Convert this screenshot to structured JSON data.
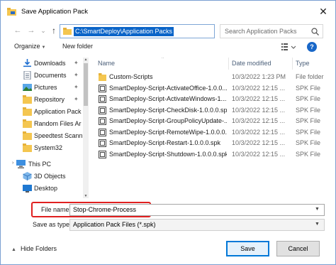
{
  "window": {
    "title": "Save Application Pack",
    "close_glyph": "✕"
  },
  "nav": {
    "back_glyph": "←",
    "forward_glyph": "→",
    "recent_glyph": "⌄",
    "up_glyph": "↑",
    "address": "C:\\SmartDeploy\\Application Packs",
    "refresh_glyph": "↻",
    "search_placeholder": "Search Application Packs"
  },
  "toolbar": {
    "organize_label": "Organize",
    "new_folder_label": "New folder",
    "help_glyph": "?"
  },
  "sidebar": {
    "items": [
      {
        "label": "Downloads",
        "icon": "download-icon",
        "pinned": true
      },
      {
        "label": "Documents",
        "icon": "document-icon",
        "pinned": true
      },
      {
        "label": "Pictures",
        "icon": "picture-icon",
        "pinned": true
      },
      {
        "label": "Repository",
        "icon": "folder-icon",
        "pinned": true
      },
      {
        "label": "Application Pack",
        "icon": "folder-icon",
        "pinned": false
      },
      {
        "label": "Random Files Ar",
        "icon": "folder-icon",
        "pinned": false
      },
      {
        "label": "Speedtest Scann",
        "icon": "folder-icon",
        "pinned": false
      },
      {
        "label": "System32",
        "icon": "folder-icon",
        "pinned": false
      },
      {
        "label": "This PC",
        "icon": "computer-icon",
        "pinned": false
      },
      {
        "label": "3D Objects",
        "icon": "cube-icon",
        "pinned": false
      },
      {
        "label": "Desktop",
        "icon": "desktop-icon",
        "pinned": false
      }
    ],
    "pin_glyph": "📌"
  },
  "columns": {
    "name": "Name",
    "date": "Date modified",
    "type": "Type"
  },
  "files": [
    {
      "name": "Custom-Scripts",
      "date": "10/3/2022 1:23 PM",
      "type": "File folder",
      "icon": "folder-icon"
    },
    {
      "name": "SmartDeploy-Script-ActivateOffice-1.0.0....",
      "date": "10/3/2022 12:15 ...",
      "type": "SPK File",
      "icon": "spk-file-icon"
    },
    {
      "name": "SmartDeploy-Script-ActivateWindows-1....",
      "date": "10/3/2022 12:15 ...",
      "type": "SPK File",
      "icon": "spk-file-icon"
    },
    {
      "name": "SmartDeploy-Script-CheckDisk-1.0.0.0.spk",
      "date": "10/3/2022 12:15 ...",
      "type": "SPK File",
      "icon": "spk-file-icon"
    },
    {
      "name": "SmartDeploy-Script-GroupPolicyUpdate-...",
      "date": "10/3/2022 12:15 ...",
      "type": "SPK File",
      "icon": "spk-file-icon"
    },
    {
      "name": "SmartDeploy-Script-RemoteWipe-1.0.0.0....",
      "date": "10/3/2022 12:15 ...",
      "type": "SPK File",
      "icon": "spk-file-icon"
    },
    {
      "name": "SmartDeploy-Script-Restart-1.0.0.0.spk",
      "date": "10/3/2022 12:15 ...",
      "type": "SPK File",
      "icon": "spk-file-icon"
    },
    {
      "name": "SmartDeploy-Script-Shutdown-1.0.0.0.spk",
      "date": "10/3/2022 12:15 ...",
      "type": "SPK File",
      "icon": "spk-file-icon"
    }
  ],
  "form": {
    "file_name_label": "File name:",
    "file_name_value": "Stop-Chrome-Process",
    "save_type_label": "Save as type:",
    "save_type_value": "Application Pack Files (*.spk)",
    "dropdown_glyph": "⌄"
  },
  "footer": {
    "hide_folders_label": "Hide Folders",
    "save_label": "Save",
    "cancel_label": "Cancel"
  },
  "colors": {
    "accent": "#0078d7",
    "address_highlight": "#0a64c8",
    "filename_highlight_border": "#e02020",
    "folder_yellow": "#f4c650"
  }
}
